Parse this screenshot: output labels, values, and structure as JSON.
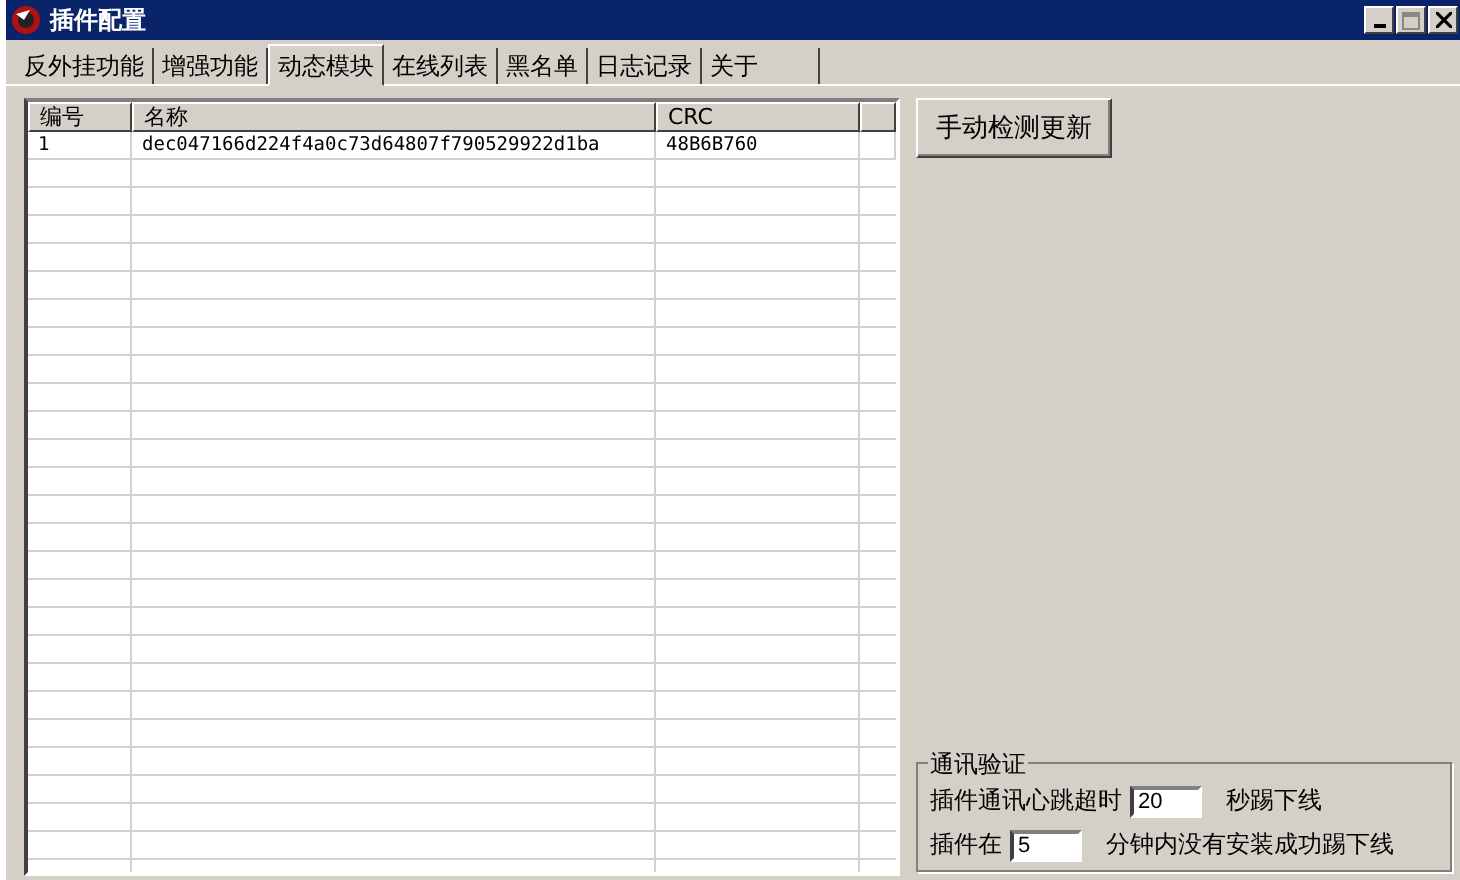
{
  "window": {
    "title": "插件配置"
  },
  "tabs": [
    {
      "label": "反外挂功能",
      "selected": false
    },
    {
      "label": "增强功能",
      "selected": false
    },
    {
      "label": "动态模块",
      "selected": true
    },
    {
      "label": "在线列表",
      "selected": false
    },
    {
      "label": "黑名单",
      "selected": false
    },
    {
      "label": "日志记录",
      "selected": false
    },
    {
      "label": "关于",
      "selected": false
    }
  ],
  "table": {
    "columns": [
      "编号",
      "名称",
      "CRC"
    ],
    "rows": [
      [
        "1",
        "dec047166d224f4a0c73d64807f790529922d1ba",
        "48B6B760"
      ]
    ]
  },
  "update_button": "手动检测更新",
  "group": {
    "title": "通讯验证",
    "line1": {
      "before": "插件通讯心跳超时",
      "value": "20",
      "after": "秒踢下线"
    },
    "line2": {
      "before": "插件在",
      "value": "5",
      "after": "分钟内没有安装成功踢下线"
    }
  }
}
